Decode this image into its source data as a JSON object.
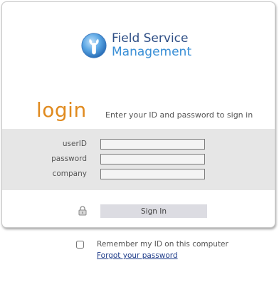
{
  "logo": {
    "line1": "Field Service",
    "line2": "Management",
    "icon": "wrench-icon"
  },
  "login": {
    "title": "login",
    "hint": "Enter your ID and password to sign in"
  },
  "form": {
    "userid_label": "userID",
    "userid_value": "",
    "password_label": "password",
    "password_value": "",
    "company_label": "company",
    "company_value": "",
    "signin_label": "Sign In"
  },
  "remember_label": "Remember my ID on this computer",
  "remember_checked": false,
  "forgot_label": "Forgot your password",
  "colors": {
    "accent": "#e08a1e",
    "brand_dark": "#2f4f86",
    "brand_light": "#3a8fd6",
    "band": "#e6e6e6"
  }
}
